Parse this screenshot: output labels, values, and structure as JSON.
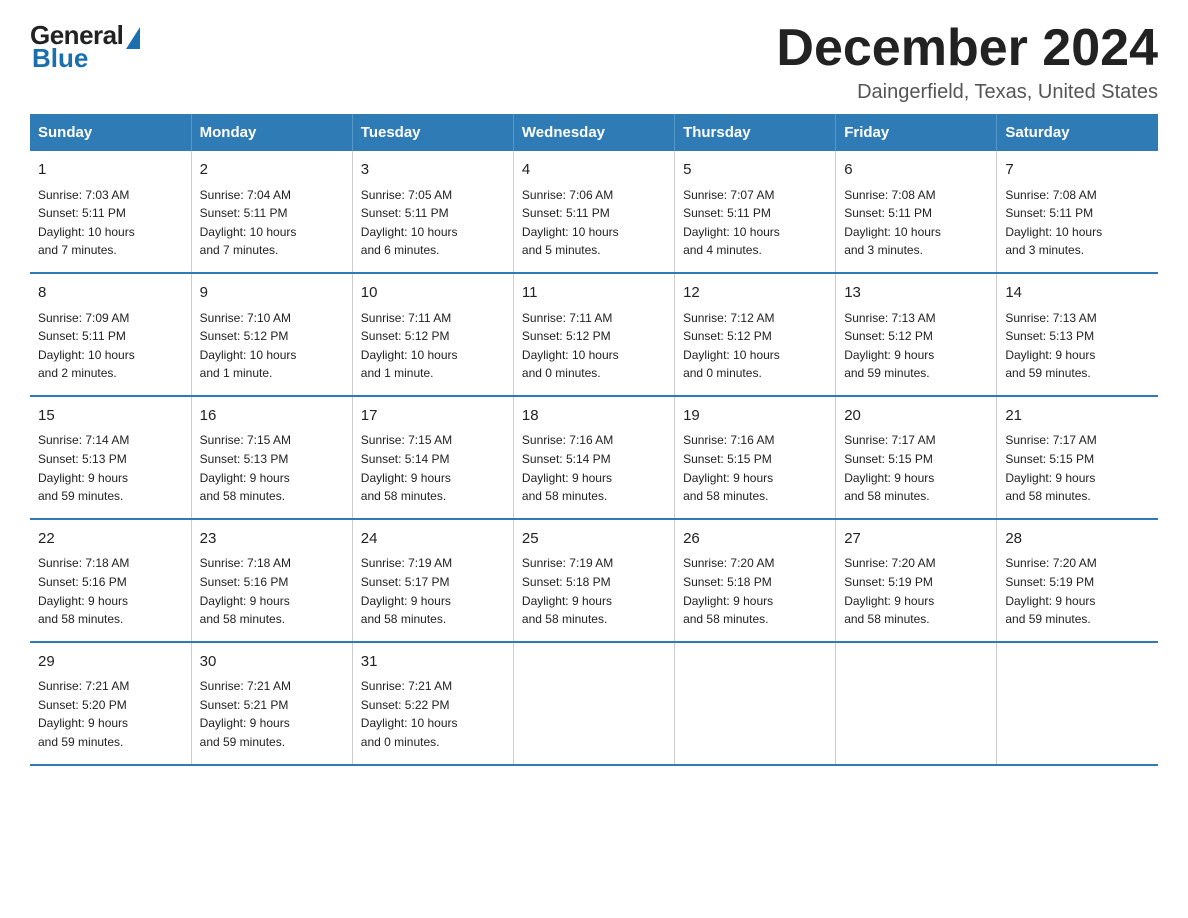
{
  "logo": {
    "general": "General",
    "blue": "Blue"
  },
  "title": "December 2024",
  "location": "Daingerfield, Texas, United States",
  "days_of_week": [
    "Sunday",
    "Monday",
    "Tuesday",
    "Wednesday",
    "Thursday",
    "Friday",
    "Saturday"
  ],
  "weeks": [
    [
      {
        "day": "1",
        "info": "Sunrise: 7:03 AM\nSunset: 5:11 PM\nDaylight: 10 hours\nand 7 minutes."
      },
      {
        "day": "2",
        "info": "Sunrise: 7:04 AM\nSunset: 5:11 PM\nDaylight: 10 hours\nand 7 minutes."
      },
      {
        "day": "3",
        "info": "Sunrise: 7:05 AM\nSunset: 5:11 PM\nDaylight: 10 hours\nand 6 minutes."
      },
      {
        "day": "4",
        "info": "Sunrise: 7:06 AM\nSunset: 5:11 PM\nDaylight: 10 hours\nand 5 minutes."
      },
      {
        "day": "5",
        "info": "Sunrise: 7:07 AM\nSunset: 5:11 PM\nDaylight: 10 hours\nand 4 minutes."
      },
      {
        "day": "6",
        "info": "Sunrise: 7:08 AM\nSunset: 5:11 PM\nDaylight: 10 hours\nand 3 minutes."
      },
      {
        "day": "7",
        "info": "Sunrise: 7:08 AM\nSunset: 5:11 PM\nDaylight: 10 hours\nand 3 minutes."
      }
    ],
    [
      {
        "day": "8",
        "info": "Sunrise: 7:09 AM\nSunset: 5:11 PM\nDaylight: 10 hours\nand 2 minutes."
      },
      {
        "day": "9",
        "info": "Sunrise: 7:10 AM\nSunset: 5:12 PM\nDaylight: 10 hours\nand 1 minute."
      },
      {
        "day": "10",
        "info": "Sunrise: 7:11 AM\nSunset: 5:12 PM\nDaylight: 10 hours\nand 1 minute."
      },
      {
        "day": "11",
        "info": "Sunrise: 7:11 AM\nSunset: 5:12 PM\nDaylight: 10 hours\nand 0 minutes."
      },
      {
        "day": "12",
        "info": "Sunrise: 7:12 AM\nSunset: 5:12 PM\nDaylight: 10 hours\nand 0 minutes."
      },
      {
        "day": "13",
        "info": "Sunrise: 7:13 AM\nSunset: 5:12 PM\nDaylight: 9 hours\nand 59 minutes."
      },
      {
        "day": "14",
        "info": "Sunrise: 7:13 AM\nSunset: 5:13 PM\nDaylight: 9 hours\nand 59 minutes."
      }
    ],
    [
      {
        "day": "15",
        "info": "Sunrise: 7:14 AM\nSunset: 5:13 PM\nDaylight: 9 hours\nand 59 minutes."
      },
      {
        "day": "16",
        "info": "Sunrise: 7:15 AM\nSunset: 5:13 PM\nDaylight: 9 hours\nand 58 minutes."
      },
      {
        "day": "17",
        "info": "Sunrise: 7:15 AM\nSunset: 5:14 PM\nDaylight: 9 hours\nand 58 minutes."
      },
      {
        "day": "18",
        "info": "Sunrise: 7:16 AM\nSunset: 5:14 PM\nDaylight: 9 hours\nand 58 minutes."
      },
      {
        "day": "19",
        "info": "Sunrise: 7:16 AM\nSunset: 5:15 PM\nDaylight: 9 hours\nand 58 minutes."
      },
      {
        "day": "20",
        "info": "Sunrise: 7:17 AM\nSunset: 5:15 PM\nDaylight: 9 hours\nand 58 minutes."
      },
      {
        "day": "21",
        "info": "Sunrise: 7:17 AM\nSunset: 5:15 PM\nDaylight: 9 hours\nand 58 minutes."
      }
    ],
    [
      {
        "day": "22",
        "info": "Sunrise: 7:18 AM\nSunset: 5:16 PM\nDaylight: 9 hours\nand 58 minutes."
      },
      {
        "day": "23",
        "info": "Sunrise: 7:18 AM\nSunset: 5:16 PM\nDaylight: 9 hours\nand 58 minutes."
      },
      {
        "day": "24",
        "info": "Sunrise: 7:19 AM\nSunset: 5:17 PM\nDaylight: 9 hours\nand 58 minutes."
      },
      {
        "day": "25",
        "info": "Sunrise: 7:19 AM\nSunset: 5:18 PM\nDaylight: 9 hours\nand 58 minutes."
      },
      {
        "day": "26",
        "info": "Sunrise: 7:20 AM\nSunset: 5:18 PM\nDaylight: 9 hours\nand 58 minutes."
      },
      {
        "day": "27",
        "info": "Sunrise: 7:20 AM\nSunset: 5:19 PM\nDaylight: 9 hours\nand 58 minutes."
      },
      {
        "day": "28",
        "info": "Sunrise: 7:20 AM\nSunset: 5:19 PM\nDaylight: 9 hours\nand 59 minutes."
      }
    ],
    [
      {
        "day": "29",
        "info": "Sunrise: 7:21 AM\nSunset: 5:20 PM\nDaylight: 9 hours\nand 59 minutes."
      },
      {
        "day": "30",
        "info": "Sunrise: 7:21 AM\nSunset: 5:21 PM\nDaylight: 9 hours\nand 59 minutes."
      },
      {
        "day": "31",
        "info": "Sunrise: 7:21 AM\nSunset: 5:22 PM\nDaylight: 10 hours\nand 0 minutes."
      },
      {
        "day": "",
        "info": ""
      },
      {
        "day": "",
        "info": ""
      },
      {
        "day": "",
        "info": ""
      },
      {
        "day": "",
        "info": ""
      }
    ]
  ]
}
